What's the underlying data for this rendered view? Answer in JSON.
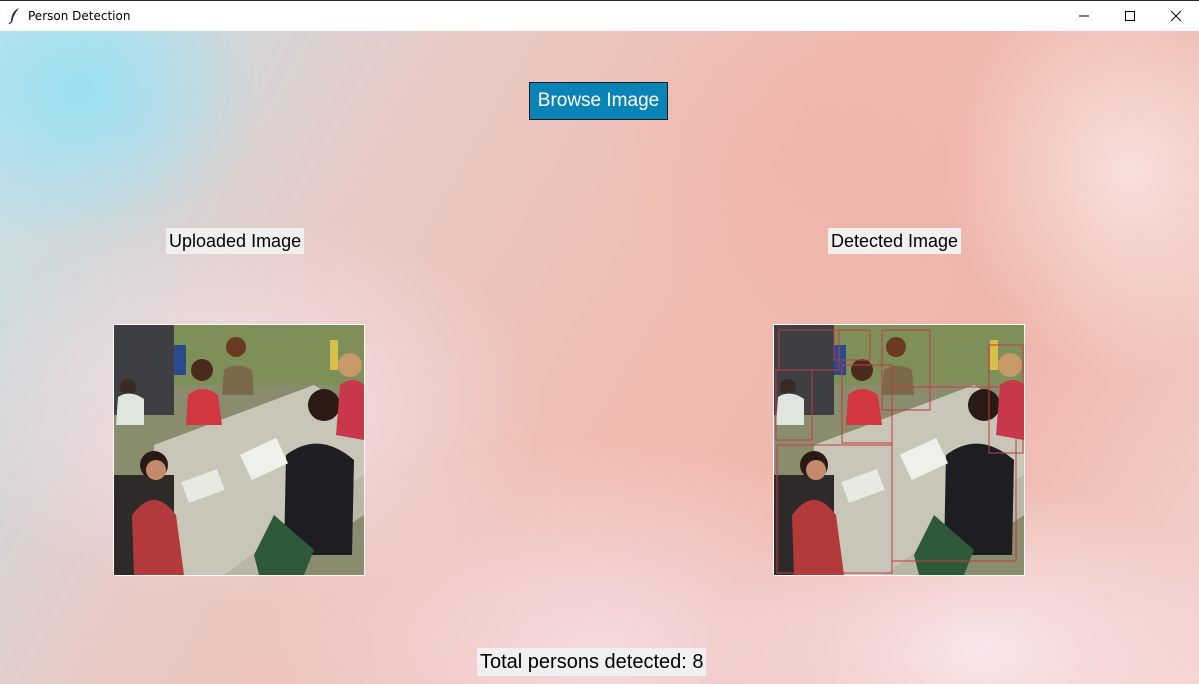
{
  "window": {
    "title": "Person Detection",
    "controls": [
      "minimize",
      "maximize",
      "close"
    ]
  },
  "main": {
    "browse_button_label": "Browse Image",
    "uploaded_label": "Uploaded Image",
    "detected_label": "Detected Image",
    "total_label": "Total persons detected: 8"
  },
  "colors": {
    "button_bg": "#0a84b6",
    "label_bg": "#f0f0f0",
    "bbox_stroke": "#c23a4a"
  },
  "detections_count": 8
}
